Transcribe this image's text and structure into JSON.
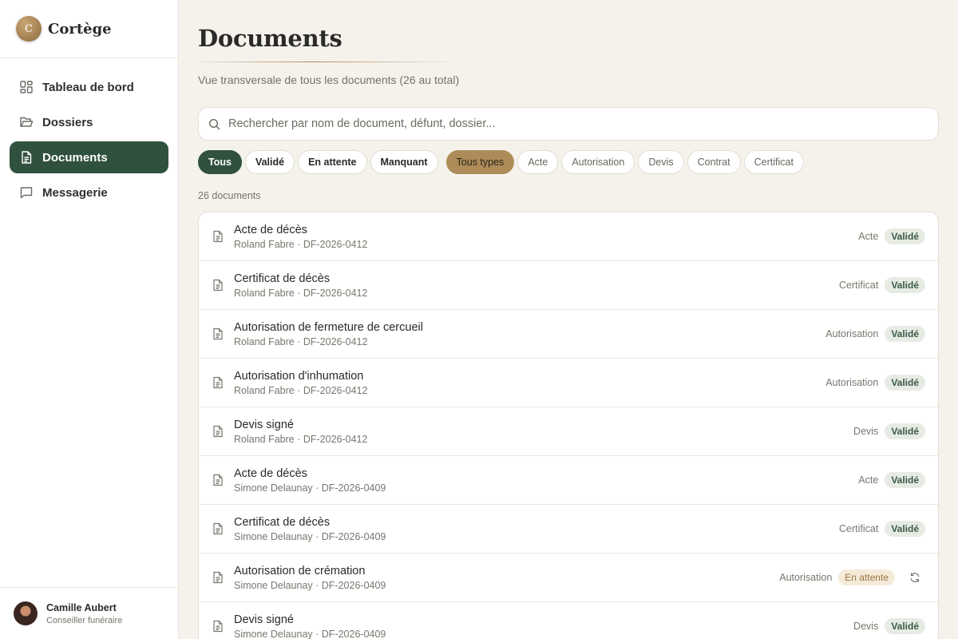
{
  "app": {
    "logo_letter": "C",
    "name": "Cortège"
  },
  "nav": [
    {
      "label": "Tableau de bord",
      "icon": "dashboard-icon",
      "active": false
    },
    {
      "label": "Dossiers",
      "icon": "folder-icon",
      "active": false
    },
    {
      "label": "Documents",
      "icon": "document-icon",
      "active": true
    },
    {
      "label": "Messagerie",
      "icon": "message-icon",
      "active": false
    }
  ],
  "user": {
    "name": "Camille Aubert",
    "role": "Conseiller funéraire"
  },
  "page": {
    "title": "Documents",
    "subtitle": "Vue transversale de tous les documents (26 au total)"
  },
  "search": {
    "placeholder": "Rechercher par nom de document, défunt, dossier...",
    "value": ""
  },
  "filters": {
    "status": [
      {
        "label": "Tous",
        "active": true
      },
      {
        "label": "Validé",
        "active": false
      },
      {
        "label": "En attente",
        "active": false
      },
      {
        "label": "Manquant",
        "active": false
      }
    ],
    "types": [
      {
        "label": "Tous types",
        "active": true
      },
      {
        "label": "Acte",
        "active": false
      },
      {
        "label": "Autorisation",
        "active": false
      },
      {
        "label": "Devis",
        "active": false
      },
      {
        "label": "Contrat",
        "active": false
      },
      {
        "label": "Certificat",
        "active": false
      }
    ]
  },
  "count_label": "26 documents",
  "documents": [
    {
      "title": "Acte de décès",
      "subtitle": "Roland Fabre · DF-2026-0412",
      "type": "Acte",
      "status": "Validé",
      "status_kind": "ok"
    },
    {
      "title": "Certificat de décès",
      "subtitle": "Roland Fabre · DF-2026-0412",
      "type": "Certificat",
      "status": "Validé",
      "status_kind": "ok"
    },
    {
      "title": "Autorisation de fermeture de cercueil",
      "subtitle": "Roland Fabre · DF-2026-0412",
      "type": "Autorisation",
      "status": "Validé",
      "status_kind": "ok"
    },
    {
      "title": "Autorisation d'inhumation",
      "subtitle": "Roland Fabre · DF-2026-0412",
      "type": "Autorisation",
      "status": "Validé",
      "status_kind": "ok"
    },
    {
      "title": "Devis signé",
      "subtitle": "Roland Fabre · DF-2026-0412",
      "type": "Devis",
      "status": "Validé",
      "status_kind": "ok"
    },
    {
      "title": "Acte de décès",
      "subtitle": "Simone Delaunay · DF-2026-0409",
      "type": "Acte",
      "status": "Validé",
      "status_kind": "ok"
    },
    {
      "title": "Certificat de décès",
      "subtitle": "Simone Delaunay · DF-2026-0409",
      "type": "Certificat",
      "status": "Validé",
      "status_kind": "ok"
    },
    {
      "title": "Autorisation de crémation",
      "subtitle": "Simone Delaunay · DF-2026-0409",
      "type": "Autorisation",
      "status": "En attente",
      "status_kind": "wait",
      "action_icon": "refresh-icon"
    },
    {
      "title": "Devis signé",
      "subtitle": "Simone Delaunay · DF-2026-0409",
      "type": "Devis",
      "status": "Validé",
      "status_kind": "ok"
    }
  ],
  "colors": {
    "accent_green": "#31513f",
    "accent_gold": "#ad8c5a",
    "background": "#f5f2ec"
  }
}
